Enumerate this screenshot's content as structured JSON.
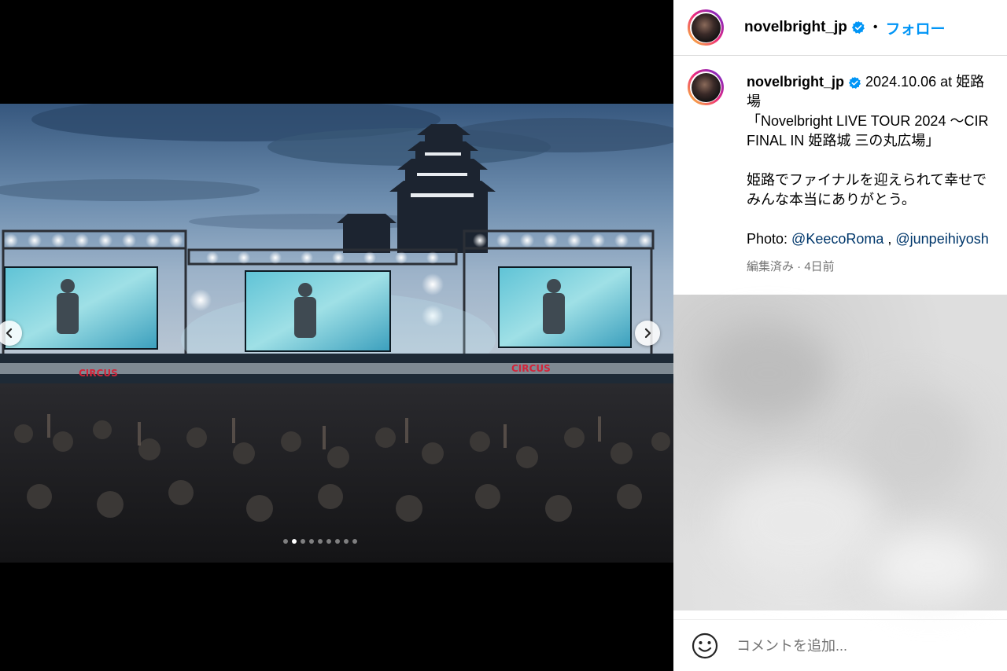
{
  "post": {
    "username": "novelbright_jp",
    "follow_label": "フォロー",
    "separator": "•",
    "icons": [
      "verified-badge-icon",
      "chevron-left-icon",
      "chevron-right-icon",
      "emoji-icon"
    ],
    "colors": {
      "accent": "#0095f6",
      "mention": "#00376b",
      "muted": "#737373"
    }
  },
  "media": {
    "carousel": {
      "total": 9,
      "current_index": 2
    }
  },
  "caption": {
    "username": "novelbright_jp",
    "line1_rest": "2024.10.06 at 姫路",
    "line2": "場",
    "line3": "「Novelbright LIVE TOUR 2024 〜CIR",
    "line4": "FINAL IN 姫路城 三の丸広場」",
    "line5": "姫路でファイナルを迎えられて幸せで",
    "line6": "みんな本当にありがとう。",
    "photo_prefix": "Photo: ",
    "mention1": "@KeecoRoma",
    "comma": " , ",
    "mention2": "@junpeihiyosh",
    "meta": "編集済み · 4日前"
  },
  "comment": {
    "placeholder": "コメントを追加..."
  }
}
